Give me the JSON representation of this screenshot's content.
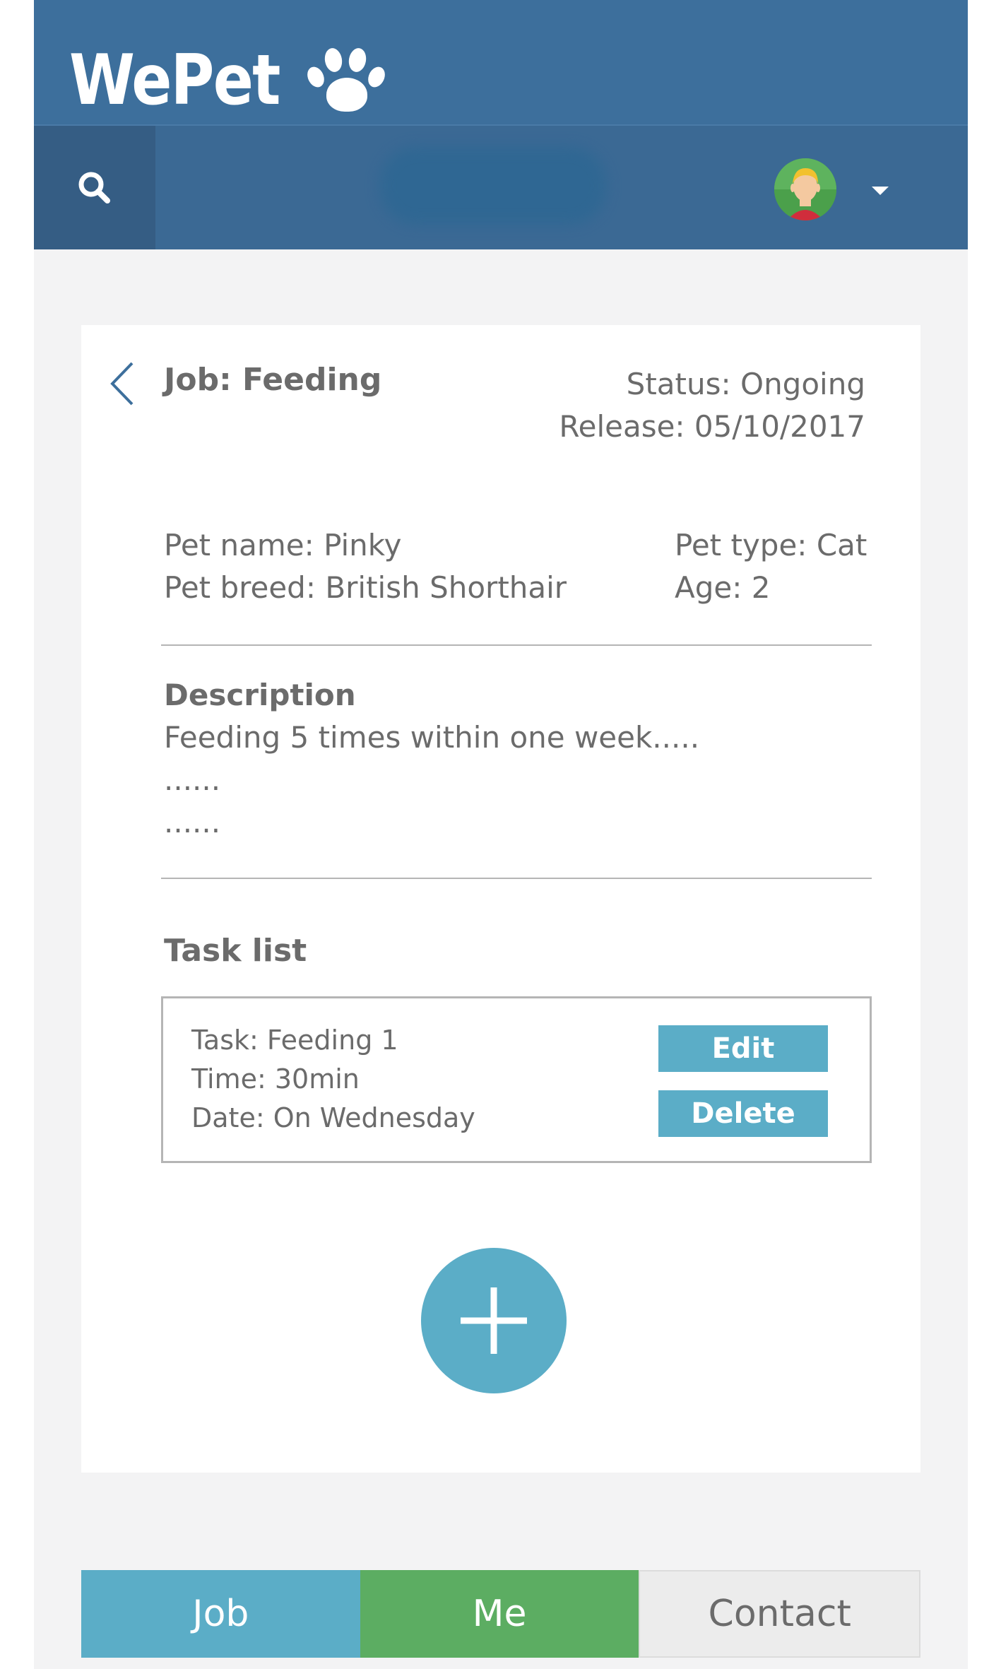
{
  "app": {
    "name": "WePet"
  },
  "colors": {
    "header": "#3d6f9c",
    "toolbar": "#3b6994",
    "accent": "#5badc7",
    "me_tab": "#5cad62",
    "contact_tab": "#ececec",
    "text": "#6b6b6b"
  },
  "toolbar": {
    "search_icon": "search-icon",
    "avatar_icon": "user-avatar",
    "menu_icon": "caret-down-icon"
  },
  "job": {
    "title": "Job: Feeding",
    "status": "Status: Ongoing",
    "release": "Release: 05/10/2017"
  },
  "pet": {
    "name": "Pet name: Pinky",
    "breed": "Pet breed: British Shorthair",
    "type": "Pet type: Cat",
    "age": "Age: 2"
  },
  "description": {
    "heading": "Description",
    "lines": [
      "Feeding 5 times within one week.....",
      "......",
      "......"
    ]
  },
  "tasks": {
    "heading": "Task list",
    "items": [
      {
        "task": "Task: Feeding 1",
        "time": "Time: 30min",
        "date": "Date: On Wednesday",
        "edit_label": "Edit",
        "delete_label": "Delete"
      }
    ],
    "add_icon": "plus-icon"
  },
  "nav": {
    "tabs": [
      {
        "label": "Job"
      },
      {
        "label": "Me"
      },
      {
        "label": "Contact"
      }
    ]
  }
}
